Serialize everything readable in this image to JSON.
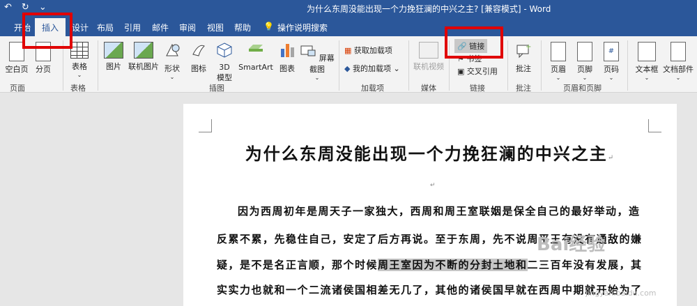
{
  "app": {
    "title": "为什么东周没能出现一个力挽狂澜的中兴之主? [兼容模式] - Word",
    "qat": {
      "undo": "↶",
      "redo": "↻",
      "more": "⌄"
    }
  },
  "tabs": [
    {
      "label": "开始"
    },
    {
      "label": "插入"
    },
    {
      "label": "设计"
    },
    {
      "label": "布局"
    },
    {
      "label": "引用"
    },
    {
      "label": "邮件"
    },
    {
      "label": "审阅"
    },
    {
      "label": "视图"
    },
    {
      "label": "帮助"
    },
    {
      "label": "操作说明搜索"
    }
  ],
  "ribbon": {
    "pages": {
      "blank": "空白页",
      "break": "分页",
      "group": "页面"
    },
    "tables": {
      "table": "表格",
      "group": "表格"
    },
    "illustrations": {
      "picture": "图片",
      "online_picture": "联机图片",
      "shapes": "形状",
      "icons": "图标",
      "model3d_line1": "3D",
      "model3d_line2": "模型",
      "smartart": "SmartArt",
      "chart": "图表",
      "screenshot": "屏幕截图",
      "group": "插图"
    },
    "addins": {
      "get": "获取加载项",
      "my": "我的加载项",
      "group": "加载项"
    },
    "media": {
      "video": "联机视频",
      "group": "媒体"
    },
    "links": {
      "link": "链接",
      "bookmark": "书签",
      "crossref": "交叉引用",
      "group": "链接"
    },
    "comments": {
      "comment": "批注",
      "group": "批注"
    },
    "header_footer": {
      "header": "页眉",
      "footer": "页脚",
      "page_number": "页码",
      "group": "页眉和页脚"
    },
    "text": {
      "textbox": "文本框",
      "parts": "文档部件"
    }
  },
  "document": {
    "heading": "为什么东周没能出现一个力挽狂澜的中兴之主",
    "para_mark": "↵",
    "lines": [
      "因为西周初年是周天子一家独大，西周和周王室联姻是保全自己的最好举动，造",
      "反累不累，先稳住自己，安定了后方再说。至于东周，先不说周平王有没有通敌的嫌",
      "疑，是不是名正言顺，那个时候",
      "周王室因为不断的分封土地和",
      "二三百年没有发展，其",
      "实实力也就和一个二流诸侯国相差无几了，其他的诸侯国早就在西周中期就开始为了"
    ]
  },
  "watermark": {
    "text": "Bai经验",
    "sub": "jingyan.baidu.com"
  },
  "colors": {
    "accent": "#2b579a",
    "highlight": "#e00000"
  }
}
